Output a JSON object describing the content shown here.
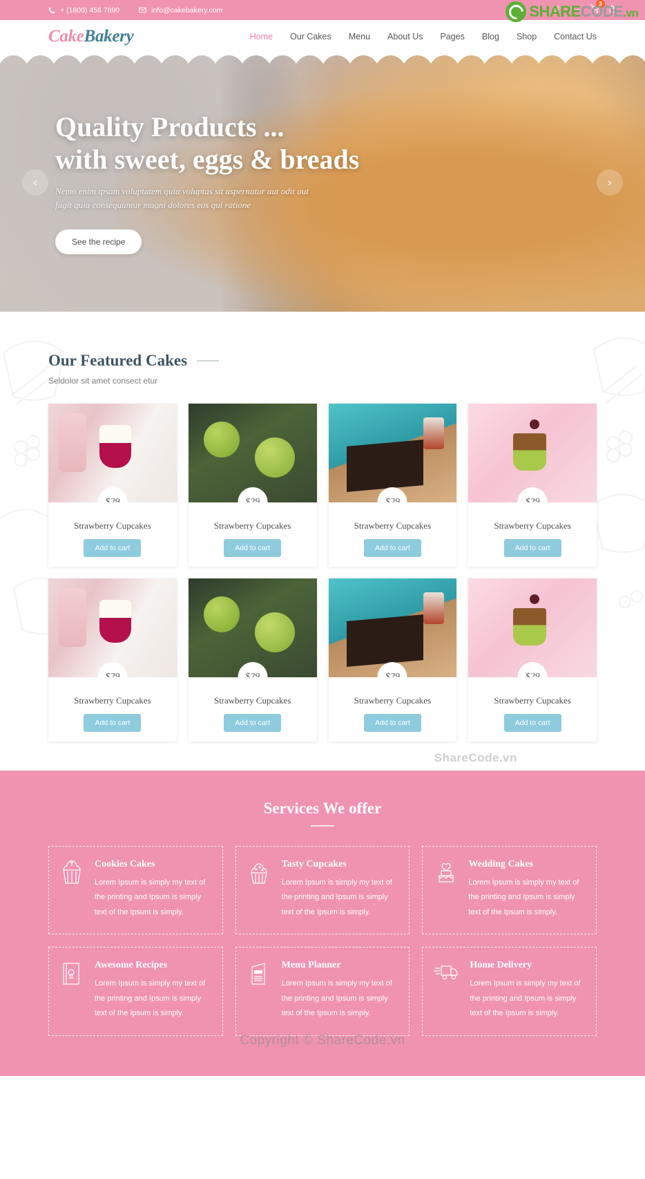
{
  "topbar": {
    "phone": "+ (1800) 456 7890",
    "email": "info@cakebakery.com",
    "phone_icon": "phone-icon",
    "email_icon": "envelope-icon",
    "social": [
      {
        "name": "facebook-icon",
        "glyph": "f"
      },
      {
        "name": "twitter-icon",
        "glyph": "t"
      },
      {
        "name": "google-plus-icon",
        "glyph": "G+"
      }
    ],
    "cart_count": "3",
    "colors": {
      "bg": "#ef93b1",
      "social": "#f7c0d3",
      "badge": "#f26a2e"
    }
  },
  "watermark": {
    "brand_a": "SHARE",
    "brand_b": "CODE",
    "brand_c": ".vn",
    "middle": "ShareCode.vn",
    "copyright": "Copyright © ShareCode.vn"
  },
  "header": {
    "logo_part1": "Cake",
    "logo_part2": "Bakery",
    "nav": [
      {
        "label": "Home",
        "active": true
      },
      {
        "label": "Our Cakes",
        "active": false
      },
      {
        "label": "Menu",
        "active": false
      },
      {
        "label": "About Us",
        "active": false
      },
      {
        "label": "Pages",
        "active": false
      },
      {
        "label": "Blog",
        "active": false
      },
      {
        "label": "Shop",
        "active": false
      },
      {
        "label": "Contact Us",
        "active": false
      }
    ],
    "colors": {
      "active": "#ef7fa4",
      "logo1": "#ef8ca8",
      "logo2": "#3e7f94"
    }
  },
  "hero": {
    "title_line1": "Quality Products ...",
    "title_line2": "with sweet, eggs & breads",
    "subtitle_line1": "Nemo enim ipsam voluptatem quia voluptas sit aspernatur aut odit aut",
    "subtitle_line2": "fugit quia consequuntur magni dolores eos qui ratione",
    "button": "See the recipe",
    "prev_icon": "chevron-left-icon",
    "next_icon": "chevron-right-icon"
  },
  "featured": {
    "title": "Our Featured Cakes",
    "subtitle": "Seldolor sit amet consect etur",
    "cart_label": "Add to cart",
    "products": [
      {
        "name": "Strawberry Cupcakes",
        "price": "$29",
        "art": "ph1"
      },
      {
        "name": "Strawberry Cupcakes",
        "price": "$29",
        "art": "ph2"
      },
      {
        "name": "Strawberry Cupcakes",
        "price": "$29",
        "art": "ph3"
      },
      {
        "name": "Strawberry Cupcakes",
        "price": "$29",
        "art": "ph4"
      },
      {
        "name": "Strawberry Cupcakes",
        "price": "$29",
        "art": "ph1"
      },
      {
        "name": "Strawberry Cupcakes",
        "price": "$29",
        "art": "ph2"
      },
      {
        "name": "Strawberry Cupcakes",
        "price": "$29",
        "art": "ph3"
      },
      {
        "name": "Strawberry Cupcakes",
        "price": "$29",
        "art": "ph4"
      }
    ],
    "colors": {
      "title": "#3d5463",
      "button": "#8ecbdd"
    }
  },
  "services": {
    "title": "Services We offer",
    "items": [
      {
        "title": "Cookies Cakes",
        "icon": "cupcake-icon",
        "text": "Lorem Ipsum is simply my text of the printing and Ipsum is simply text of the Ipsum is simply."
      },
      {
        "title": "Tasty Cupcakes",
        "icon": "cupcake-alt-icon",
        "text": "Lorem Ipsum is simply my text of the printing and Ipsum is simply text of the Ipsum is simply."
      },
      {
        "title": "Wedding Cakes",
        "icon": "wedding-cake-icon",
        "text": "Lorem Ipsum is simply my text of the printing and Ipsum is simply text of the Ipsum is simply."
      },
      {
        "title": "Awesome Recipes",
        "icon": "recipe-book-icon",
        "text": "Lorem Ipsum is simply my text of the printing and Ipsum is simply text of the Ipsum is simply."
      },
      {
        "title": "Menu Planner",
        "icon": "menu-card-icon",
        "text": "Lorem Ipsum is simply my text of the printing and Ipsum is simply text of the Ipsum is simply."
      },
      {
        "title": "Home Delivery",
        "icon": "delivery-truck-icon",
        "text": "Lorem Ipsum is simply my text of the printing and Ipsum is simply text of the Ipsum is simply."
      }
    ],
    "colors": {
      "bg": "#ef93b1"
    }
  }
}
